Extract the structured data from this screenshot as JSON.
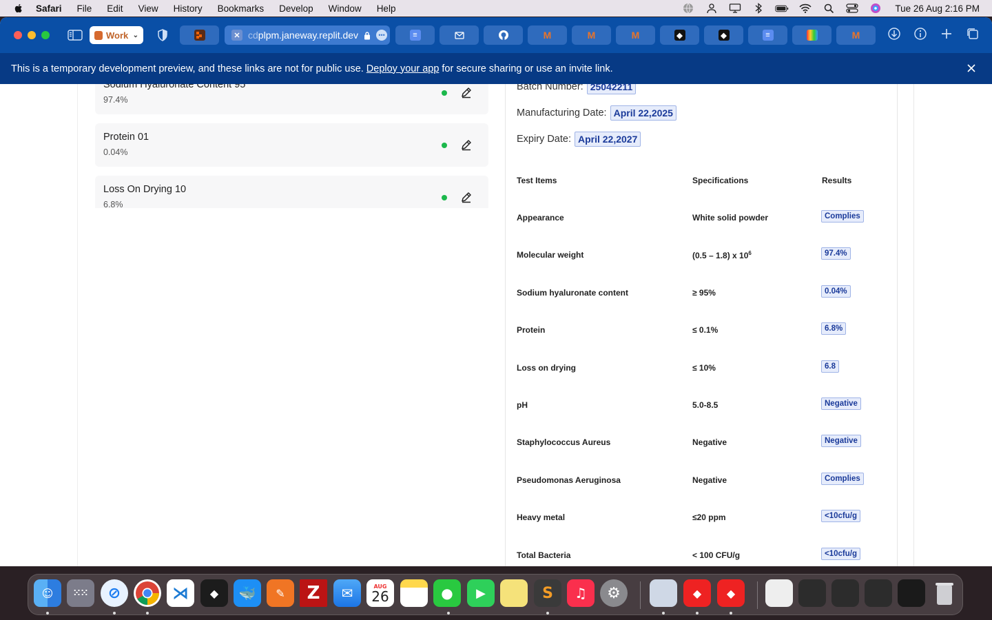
{
  "menubar": {
    "app": "Safari",
    "items": [
      "File",
      "Edit",
      "View",
      "History",
      "Bookmarks",
      "Develop",
      "Window",
      "Help"
    ],
    "clock": "Tue 26 Aug  2:16 PM"
  },
  "toolbar": {
    "profile_label": "Work",
    "url_dim": "cd",
    "url_main": "plpm.janeway.replit.dev"
  },
  "banner": {
    "text_before": "This is a temporary development preview, and these links are not for public use.",
    "link": "Deploy your app",
    "text_after": "for secure sharing or use an invite link."
  },
  "tests": [
    {
      "name": "Sodium Hyaluronate Content 95",
      "value": "97.4%"
    },
    {
      "name": "Protein 01",
      "value": "0.04%"
    },
    {
      "name": "Loss On Drying 10",
      "value": "6.8%"
    }
  ],
  "certificate": {
    "batch_label": "Batch Number:",
    "batch_value": "25042211",
    "mfg_label": "Manufacturing Date:",
    "mfg_value": "April 22,2025",
    "exp_label": "Expiry Date:",
    "exp_value": "April 22,2027",
    "headers": {
      "item": "Test Items",
      "spec": "Specifications",
      "result": "Results"
    },
    "rows": [
      {
        "item": "Appearance",
        "spec": "White solid powder",
        "result": "Complies"
      },
      {
        "item": "Molecular weight",
        "spec": "(0.5 – 1.8) x 10",
        "spec_sup": "6",
        "result": "97.4%"
      },
      {
        "item": "Sodium hyaluronate content",
        "spec": "≥ 95%",
        "result": "0.04%"
      },
      {
        "item": "Protein",
        "spec": "≤ 0.1%",
        "result": "6.8%"
      },
      {
        "item": "Loss on drying",
        "spec": "≤ 10%",
        "result": "6.8"
      },
      {
        "item": "pH",
        "spec": "5.0-8.5",
        "result": "Negative"
      },
      {
        "item": "Staphylococcus Aureus",
        "spec": "Negative",
        "result": "Negative"
      },
      {
        "item": "Pseudomonas Aeruginosa",
        "spec": "Negative",
        "result": "Complies"
      },
      {
        "item": "Heavy metal",
        "spec": "≤20 ppm",
        "result": "<10cfu/g"
      },
      {
        "item": "Total Bacteria",
        "spec": "< 100 CFU/g",
        "result": "<10cfu/g"
      }
    ]
  },
  "dock": {
    "calendar_month": "AUG",
    "calendar_day": "26"
  },
  "colors": {
    "toolbar": "#0a4fa6",
    "banner": "#073a85",
    "status_dot": "#1cb84c",
    "highlight_bg": "#e6ecfb",
    "highlight_text": "#1a3a9a"
  }
}
